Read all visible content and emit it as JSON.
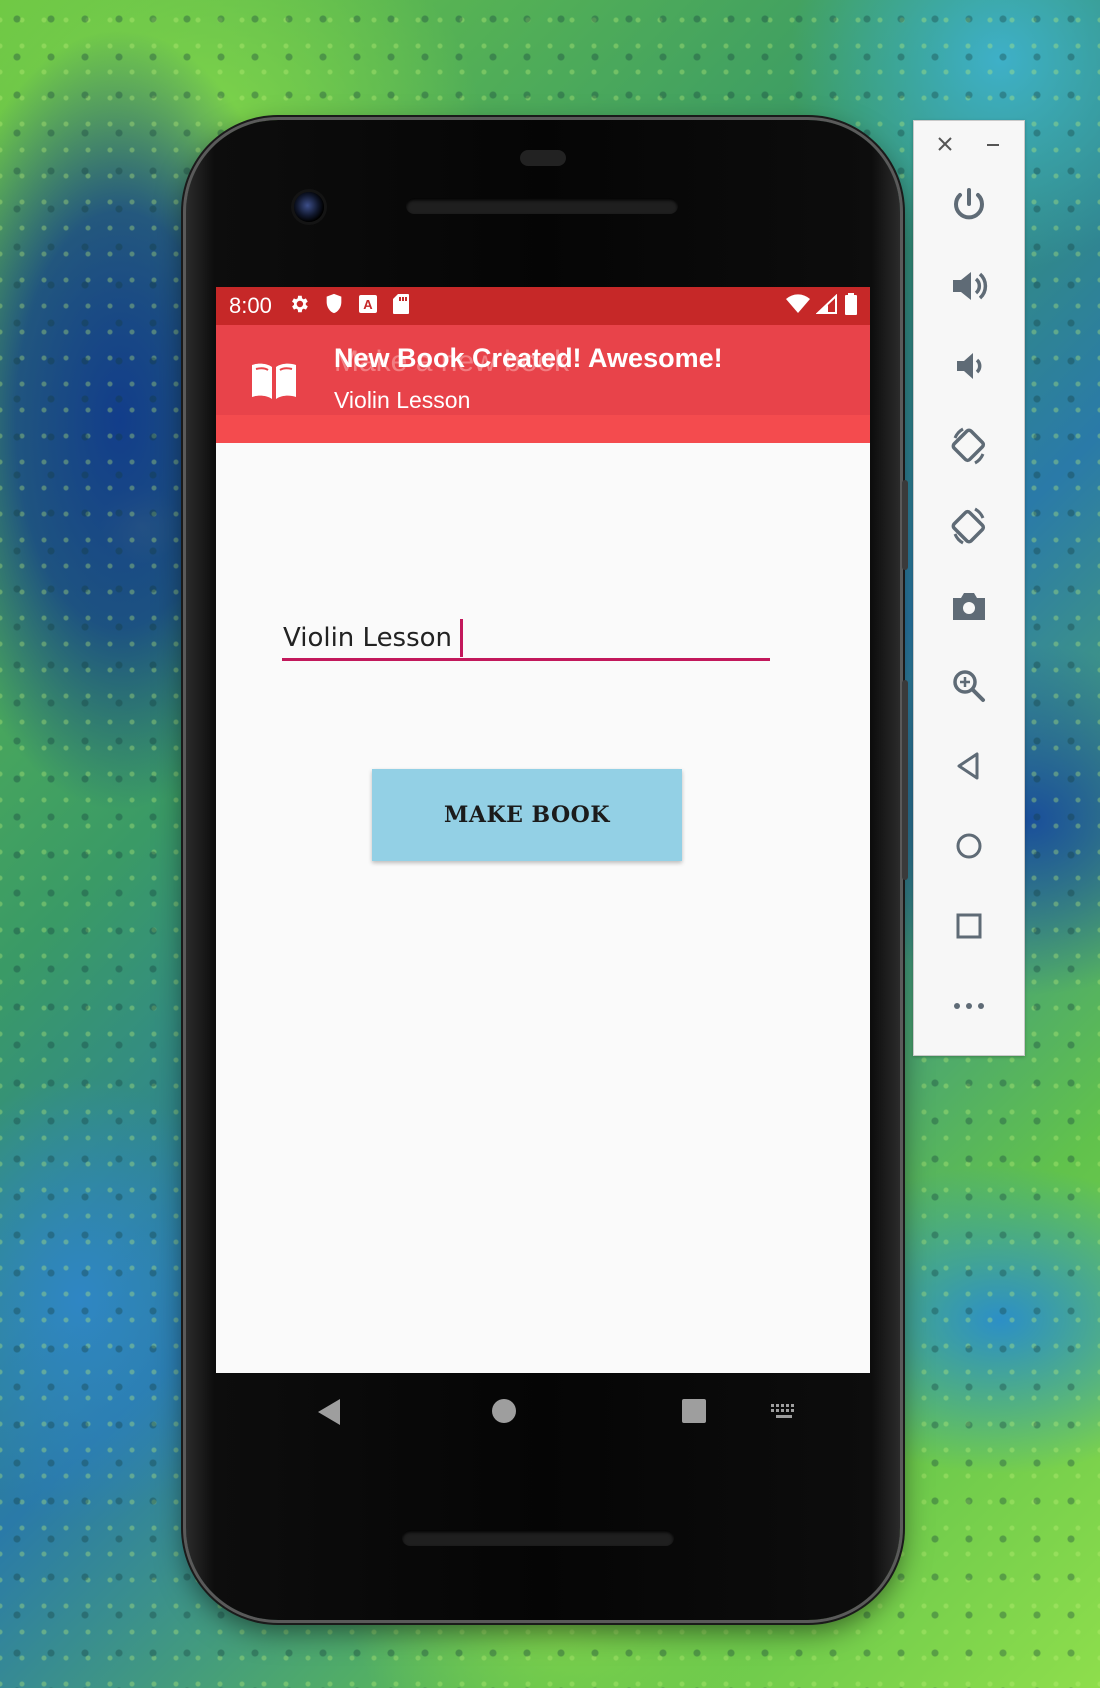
{
  "statusBar": {
    "time": "8:00",
    "leftIcons": [
      "settings-icon",
      "shield-icon",
      "a-icon",
      "sd-card-icon"
    ],
    "rightIcons": [
      "wifi-icon",
      "signal-icon",
      "battery-icon"
    ]
  },
  "notification": {
    "title": "New Book Created! Awesome!",
    "subtitle": "Violin Lesson",
    "icon": "book-icon"
  },
  "appBar": {
    "title": "Make a new book"
  },
  "form": {
    "bookTitleValue": "Violin Lesson",
    "makeButtonLabel": "MAKE BOOK"
  },
  "navBar": {
    "items": [
      "back-icon",
      "home-icon",
      "recents-icon",
      "keyboard-icon"
    ]
  },
  "emulatorToolbar": {
    "items": [
      "close-icon",
      "minimize-icon",
      "power-icon",
      "volume-up-icon",
      "volume-down-icon",
      "rotate-left-icon",
      "rotate-right-icon",
      "camera-icon",
      "zoom-icon",
      "back-icon",
      "home-icon",
      "overview-icon",
      "more-icon"
    ]
  },
  "colors": {
    "statusBar": "#c62828",
    "appBar": "#f44b4e",
    "accent": "#c2185b",
    "button": "#93d0e5",
    "screenBackground": "#fafafa"
  }
}
